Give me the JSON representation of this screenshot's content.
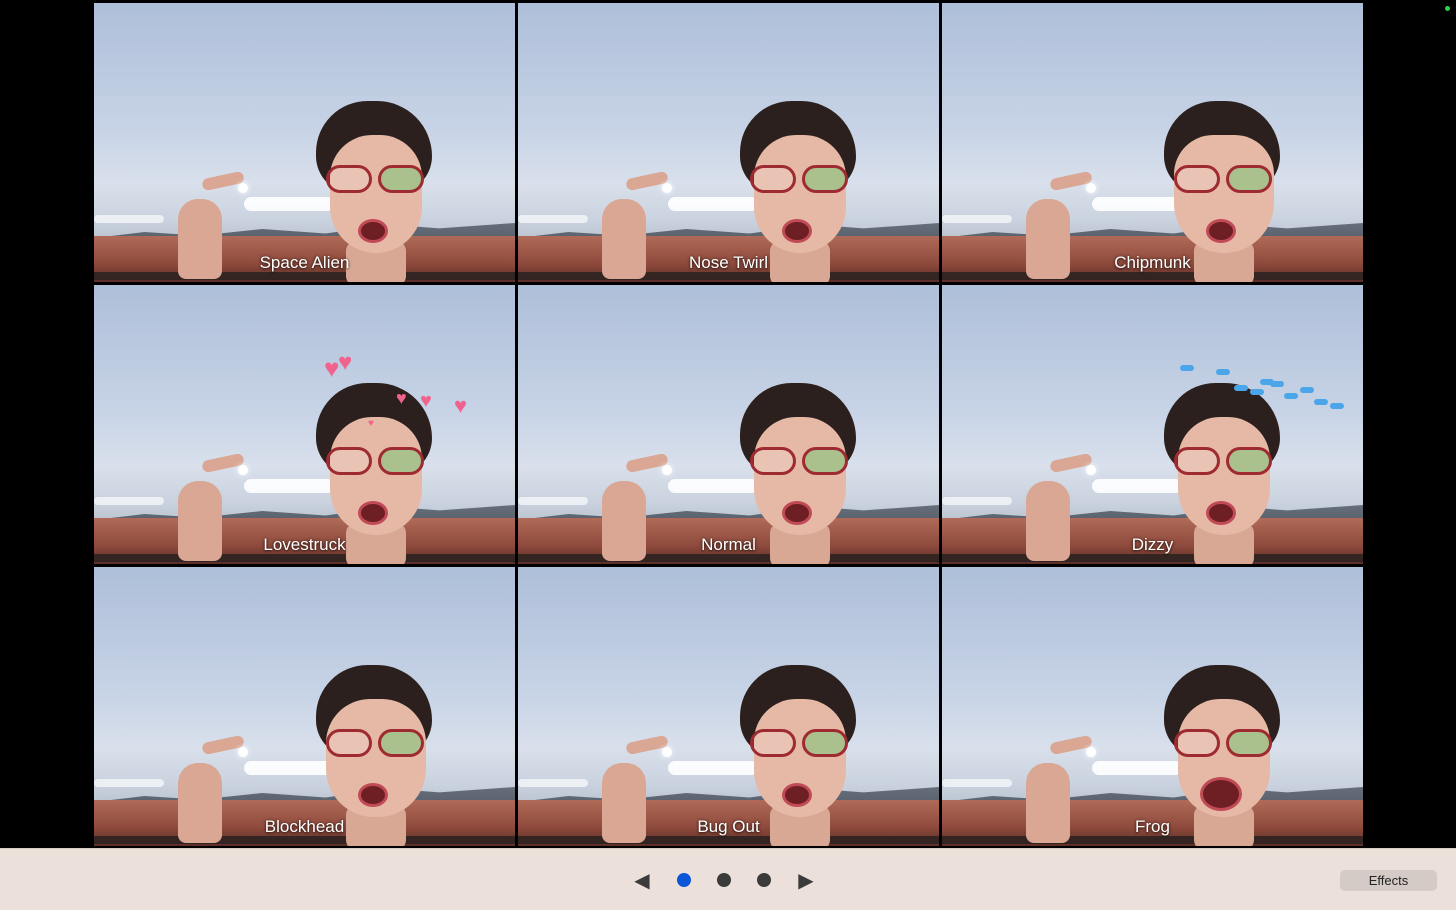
{
  "effects_grid": {
    "tiles": [
      {
        "label": "Space Alien",
        "effect": "space-alien"
      },
      {
        "label": "Nose Twirl",
        "effect": "nose-twirl"
      },
      {
        "label": "Chipmunk",
        "effect": "chipmunk"
      },
      {
        "label": "Lovestruck",
        "effect": "lovestruck"
      },
      {
        "label": "Normal",
        "effect": "normal"
      },
      {
        "label": "Dizzy",
        "effect": "dizzy"
      },
      {
        "label": "Blockhead",
        "effect": "blockhead"
      },
      {
        "label": "Bug Out",
        "effect": "bug-out"
      },
      {
        "label": "Frog",
        "effect": "frog"
      }
    ],
    "selected": "Normal"
  },
  "toolbar": {
    "prev_icon": "triangle-left-icon",
    "next_icon": "triangle-right-icon",
    "page_count": 3,
    "current_page": 1,
    "effects_label": "Effects",
    "active_dot_color": "#0a56d6",
    "inactive_dot_color": "#3b3b3b",
    "background_color": "#ebe0da"
  },
  "indicators": {
    "camera_status_color": "#2bd24f"
  }
}
